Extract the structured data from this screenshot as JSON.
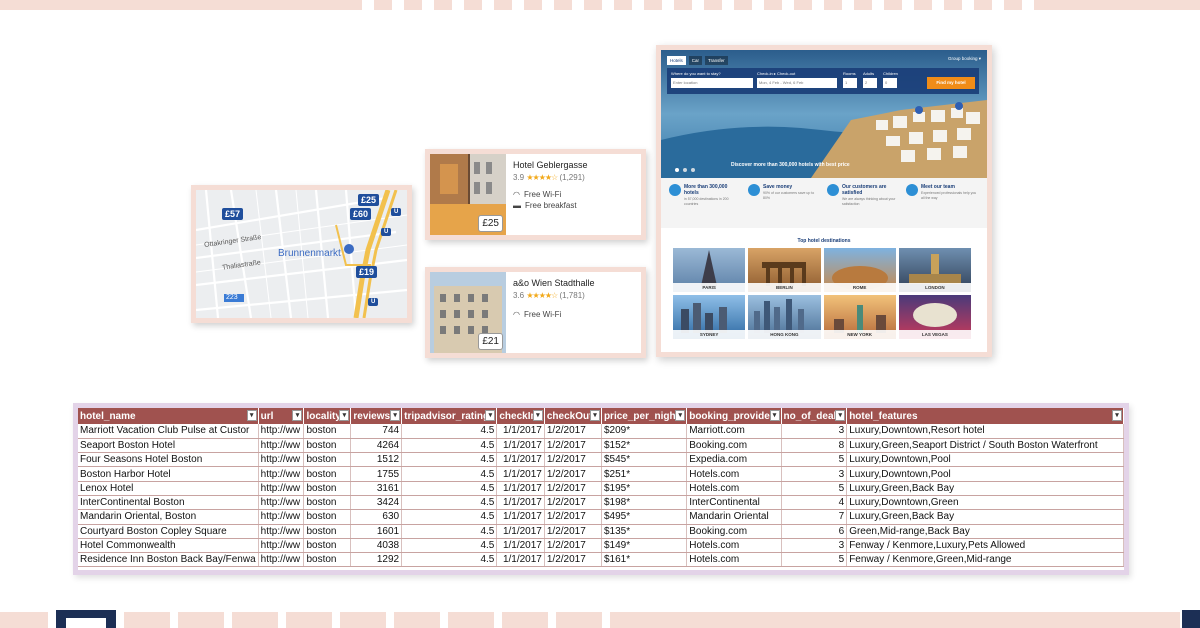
{
  "map": {
    "pins": [
      "£57",
      "£25",
      "£60",
      "£19"
    ],
    "streets": [
      "Ottakringer Straße",
      "Thaliastraße"
    ],
    "poi": "Brunnenmarkt",
    "route_labels": [
      "U",
      "U",
      "U",
      "223"
    ]
  },
  "hotels": [
    {
      "name": "Hotel Geblergasse",
      "rating": "3.9",
      "stars": "★★★★☆",
      "reviews": "(1,291)",
      "price": "£25",
      "amenities": [
        "Free Wi-Fi",
        "Free breakfast"
      ]
    },
    {
      "name": "a&o Wien Stadthalle",
      "rating": "3.6",
      "stars": "★★★★☆",
      "reviews": "(1,781)",
      "price": "£21",
      "amenities": [
        "Free Wi-Fi"
      ]
    }
  ],
  "site": {
    "tabs": [
      "Hotels",
      "Car",
      "Transfer"
    ],
    "group_booking": "Group booking ▾",
    "search": {
      "where_label": "Where do you want to stay?",
      "where_placeholder": "Enter location",
      "dates_label": "Check-in ▸ Check-out",
      "dates_value": "Mon, 4 Feb - Wed, 6 Feb",
      "rooms_label": "Rooms",
      "adults_label": "Adults",
      "children_label": "Children",
      "rooms_value": "1",
      "adults_value": "2",
      "children_value": "0",
      "button": "Find my hotel"
    },
    "hero_caption": "Discover more than 300,000 hotels with best price",
    "features": [
      {
        "title": "More than 300,000 hotels",
        "sub": "in 57,000 destinations in 200 countries"
      },
      {
        "title": "Save money",
        "sub": "90% of our customers save up to 80%"
      },
      {
        "title": "Our customers are satisfied",
        "sub": "We are always thinking about your satisfaction"
      },
      {
        "title": "Meet our team",
        "sub": "Experienced professionals help you all the way"
      }
    ],
    "destinations_title": "Top hotel destinations",
    "destinations": [
      "PARIS",
      "BERLIN",
      "ROME",
      "LONDON",
      "SYDNEY",
      "HONG KONG",
      "NEW YORK",
      "LAS VEGAS"
    ]
  },
  "sheet": {
    "headers": [
      "hotel_name",
      "url",
      "locality",
      "reviews",
      "tripadvisor_rating",
      "checkIn",
      "checkOut",
      "price_per_night",
      "booking_provider",
      "no_of_deals",
      "hotel_features"
    ],
    "rows": [
      [
        "Marriott Vacation Club Pulse at Custor",
        "http://ww",
        "boston",
        "744",
        "4.5",
        "1/1/2017",
        "1/2/2017",
        "$209*",
        "Marriott.com",
        "3",
        "Luxury,Downtown,Resort hotel"
      ],
      [
        "Seaport Boston Hotel",
        "http://ww",
        "boston",
        "4264",
        "4.5",
        "1/1/2017",
        "1/2/2017",
        "$152*",
        "Booking.com",
        "8",
        "Luxury,Green,Seaport District / South Boston Waterfront"
      ],
      [
        "Four Seasons Hotel Boston",
        "http://ww",
        "boston",
        "1512",
        "4.5",
        "1/1/2017",
        "1/2/2017",
        "$545*",
        "Expedia.com",
        "5",
        "Luxury,Downtown,Pool"
      ],
      [
        "Boston Harbor Hotel",
        "http://ww",
        "boston",
        "1755",
        "4.5",
        "1/1/2017",
        "1/2/2017",
        "$251*",
        "Hotels.com",
        "3",
        "Luxury,Downtown,Pool"
      ],
      [
        "Lenox Hotel",
        "http://ww",
        "boston",
        "3161",
        "4.5",
        "1/1/2017",
        "1/2/2017",
        "$195*",
        "Hotels.com",
        "5",
        "Luxury,Green,Back Bay"
      ],
      [
        "InterContinental Boston",
        "http://ww",
        "boston",
        "3424",
        "4.5",
        "1/1/2017",
        "1/2/2017",
        "$198*",
        "InterContinental",
        "4",
        "Luxury,Downtown,Green"
      ],
      [
        "Mandarin Oriental, Boston",
        "http://ww",
        "boston",
        "630",
        "4.5",
        "1/1/2017",
        "1/2/2017",
        "$495*",
        "Mandarin Oriental",
        "7",
        "Luxury,Green,Back Bay"
      ],
      [
        "Courtyard Boston Copley Square",
        "http://ww",
        "boston",
        "1601",
        "4.5",
        "1/1/2017",
        "1/2/2017",
        "$135*",
        "Booking.com",
        "6",
        "Green,Mid-range,Back Bay"
      ],
      [
        "Hotel Commonwealth",
        "http://ww",
        "boston",
        "4038",
        "4.5",
        "1/1/2017",
        "1/2/2017",
        "$149*",
        "Hotels.com",
        "3",
        "Fenway / Kenmore,Luxury,Pets Allowed"
      ],
      [
        "Residence Inn Boston Back Bay/Fenwa",
        "http://ww",
        "boston",
        "1292",
        "4.5",
        "1/1/2017",
        "1/2/2017",
        "$161*",
        "Hotels.com",
        "5",
        "Fenway / Kenmore,Green,Mid-range"
      ]
    ]
  },
  "colors": {
    "accent_pink": "#f5ddd5",
    "sheet_header": "#a0524f",
    "map_pin": "#1f4e9c",
    "site_navy": "#1a3e78",
    "cta_orange": "#f08c18",
    "frame_lilac": "#e3d3e8"
  }
}
